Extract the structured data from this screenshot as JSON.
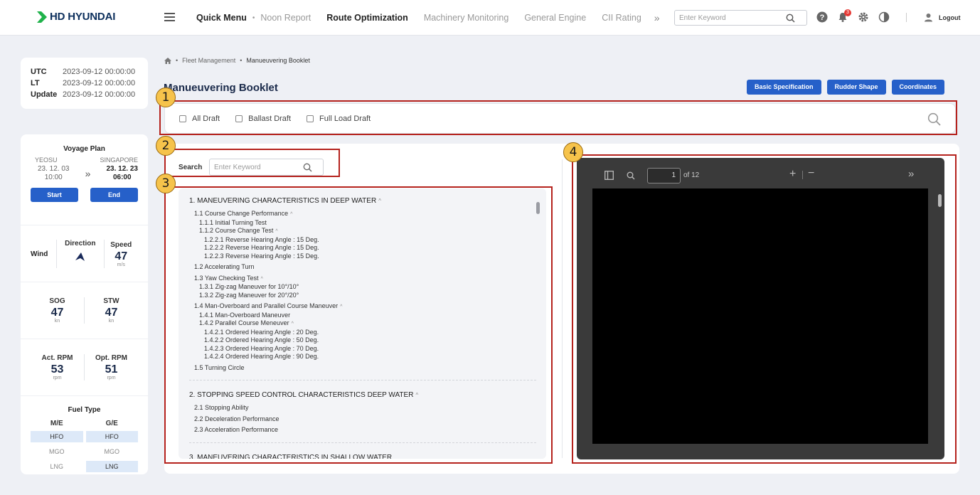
{
  "header": {
    "brand": "HD HYUNDAI",
    "nav": [
      {
        "label": "Quick Menu",
        "bold": true
      },
      {
        "label": "Noon Report",
        "bold": false
      },
      {
        "label": "Route Optimization",
        "bold": true
      },
      {
        "label": "Machinery Monitoring",
        "bold": false
      },
      {
        "label": "General Engine",
        "bold": false
      },
      {
        "label": "CII Rating",
        "bold": false
      }
    ],
    "more_icon": "double-chevron-right",
    "search_placeholder": "Enter Keyword",
    "notification_count": "3",
    "logout_label": "Logout"
  },
  "time_info": {
    "utc_label": "UTC",
    "utc_value": "2023-09-12 00:00:00",
    "lt_label": "LT",
    "lt_value": "2023-09-12 00:00:00",
    "update_label": "Update",
    "update_value": "2023-09-12 00:00:00"
  },
  "voyage": {
    "title": "Voyage Plan",
    "from_port": "YEOSU",
    "to_port": "SINGAPORE",
    "from_date": "23. 12. 03",
    "from_time": "10:00",
    "to_date": "23. 12. 23",
    "to_time": "06:00",
    "start_label": "Start",
    "end_label": "End"
  },
  "wind": {
    "label": "Wind",
    "direction_label": "Direction",
    "speed_label": "Speed",
    "speed_value": "47",
    "speed_unit": "m/s"
  },
  "speed": {
    "sog_label": "SOG",
    "sog_value": "47",
    "sog_unit": "kn",
    "stw_label": "STW",
    "stw_value": "47",
    "stw_unit": "kn"
  },
  "rpm": {
    "act_label": "Act. RPM",
    "act_value": "53",
    "act_unit": "rpm",
    "opt_label": "Opt. RPM",
    "opt_value": "51",
    "opt_unit": "rpm"
  },
  "fuel": {
    "title": "Fuel Type",
    "me_label": "M/E",
    "ge_label": "G/E",
    "rows": [
      {
        "me": "HFO",
        "me_on": true,
        "ge": "HFO",
        "ge_on": true
      },
      {
        "me": "MGO",
        "me_on": false,
        "ge": "MGO",
        "ge_on": false
      },
      {
        "me": "LNG",
        "me_on": false,
        "ge": "LNG",
        "ge_on": true
      }
    ]
  },
  "breadcrumb": {
    "parent": "Fleet Management",
    "current": "Manueuvering Booklet"
  },
  "page_title": "Manueuvering Booklet",
  "actions": {
    "basic_spec": "Basic Specification",
    "rudder_shape": "Rudder Shape",
    "coordinates": "Coordinates"
  },
  "filters": {
    "all": "All Draft",
    "ballast": "Ballast Draft",
    "full_load": "Full Load Draft"
  },
  "search": {
    "label": "Search",
    "placeholder": "Enter Keyword"
  },
  "toc": [
    {
      "title": "1.  MANEUVERING CHARACTERISTICS IN DEEP WATER",
      "items": [
        {
          "level": 1,
          "text": "1.1  Course Change Performance",
          "caret": true
        },
        {
          "level": 2,
          "text": "1.1.1  Initial Turning Test",
          "caret": false
        },
        {
          "level": 2,
          "text": "1.1.2  Course Change Test",
          "caret": true
        },
        {
          "level": 3,
          "text": "1.2.2.1  Reverse Hearing Angle : 15 Deg.",
          "caret": false
        },
        {
          "level": 3,
          "text": "1.2.2.2  Reverse Hearing Angle : 15 Deg.",
          "caret": false
        },
        {
          "level": 3,
          "text": "1.2.2.3  Reverse Hearing Angle : 15 Deg.",
          "caret": false
        },
        {
          "level": 1,
          "text": "1.2  Accelerating Turn",
          "caret": false,
          "gap": true
        },
        {
          "level": 1,
          "text": "1.3  Yaw Checking Test",
          "caret": true,
          "gap": true
        },
        {
          "level": 2,
          "text": "1.3.1  Zig-zag Maneuver for 10°/10°",
          "caret": false
        },
        {
          "level": 2,
          "text": "1.3.2  Zig-zag Maneuver for 20°/20°",
          "caret": false
        },
        {
          "level": 1,
          "text": "1.4  Man-Overboard and Parallel Course Maneuver",
          "caret": true,
          "gap": true
        },
        {
          "level": 2,
          "text": "1.4.1  Man-Overboard Maneuver",
          "caret": false
        },
        {
          "level": 2,
          "text": "1.4.2  Parallel Course Meneuver",
          "caret": true
        },
        {
          "level": 3,
          "text": "1.4.2.1  Ordered Hearing Angle : 20 Deg.",
          "caret": false
        },
        {
          "level": 3,
          "text": "1.4.2.2  Ordered Hearing Angle : 50 Deg.",
          "caret": false
        },
        {
          "level": 3,
          "text": "1.4.2.3  Ordered Hearing Angle : 70 Deg.",
          "caret": false
        },
        {
          "level": 3,
          "text": "1.4.2.4  Ordered Hearing Angle : 90 Deg.",
          "caret": false
        },
        {
          "level": 1,
          "text": "1.5  Turning Circle",
          "caret": false,
          "gap": true
        }
      ]
    },
    {
      "title": "2.  STOPPING SPEED CONTROL CHARACTERISTICS DEEP WATER",
      "items": [
        {
          "level": 1,
          "text": "2.1  Stopping Ability",
          "caret": false
        },
        {
          "level": 1,
          "text": "2.2  Deceleration Performance",
          "caret": false,
          "gap": true
        },
        {
          "level": 1,
          "text": "2.3  Acceleration Performance",
          "caret": false,
          "gap": true
        }
      ]
    },
    {
      "title": "3.  MANEUVERING CHARACTERISTICS IN SHALLOW WATER",
      "items": []
    }
  ],
  "viewer": {
    "page": "1",
    "of_label": "of 12"
  },
  "annotations": [
    "1",
    "2",
    "3",
    "4"
  ]
}
